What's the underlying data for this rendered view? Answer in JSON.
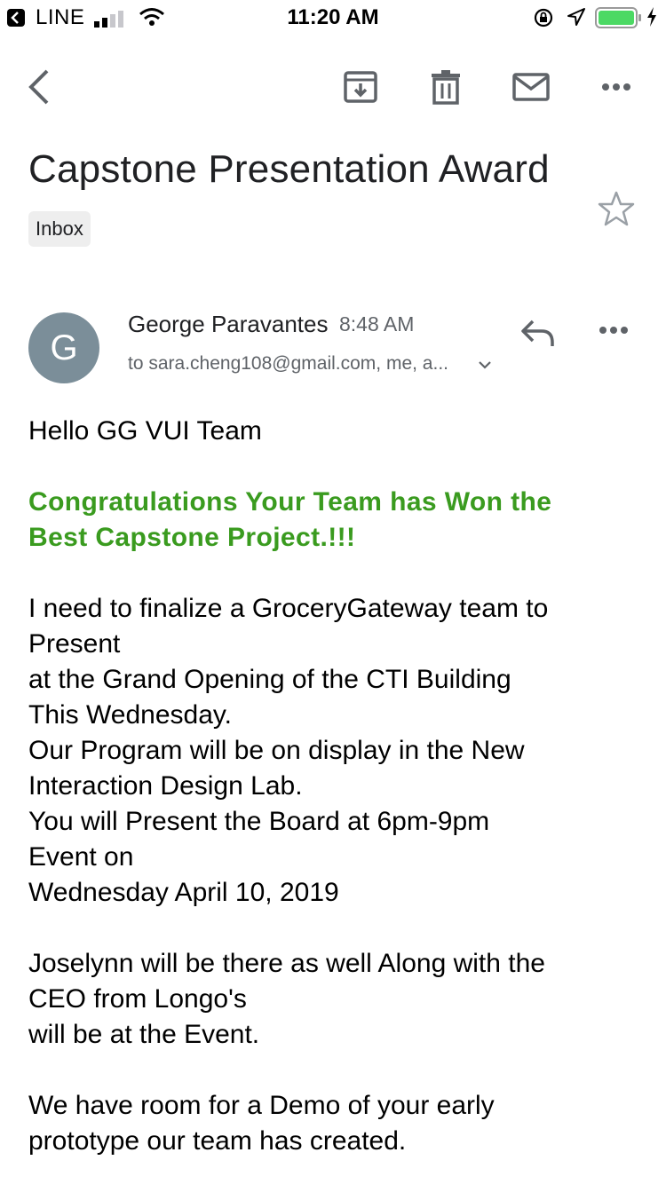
{
  "status_bar": {
    "back_app": "LINE",
    "time": "11:20 AM",
    "battery_color": "#4cd964"
  },
  "toolbar": {
    "icons": [
      "back-arrow-icon",
      "archive-icon",
      "trash-icon",
      "mail-icon",
      "more-icon"
    ]
  },
  "email": {
    "subject": "Capstone Presentation Award",
    "label": "Inbox",
    "sender": {
      "initial": "G",
      "name": "George Paravantes",
      "time": "8:48 AM",
      "recipients": "to sara.cheng108@gmail.com, me, a..."
    },
    "body": {
      "greeting": "Hello GG VUI Team",
      "congrats_lines": [
        "Congratulations Your Team has Won the",
        "Best Capstone Project.!!!"
      ],
      "para1_lines": [
        "I need to finalize a GroceryGateway team to",
        "Present",
        "at the Grand Opening of the CTI Building",
        "This Wednesday.",
        "Our Program will be on display in the New",
        "Interaction Design Lab.",
        "You will Present the Board at 6pm-9pm",
        "Event on",
        "Wednesday April 10, 2019"
      ],
      "para2_lines": [
        "Joselynn will be there as well Along with the",
        "CEO from Longo's",
        "will be at the Event."
      ],
      "para3_lines": [
        "We have room for a Demo of your early",
        "prototype our team has created."
      ]
    },
    "accent_color": "#3a9b1f",
    "avatar_color": "#7b8e99"
  }
}
